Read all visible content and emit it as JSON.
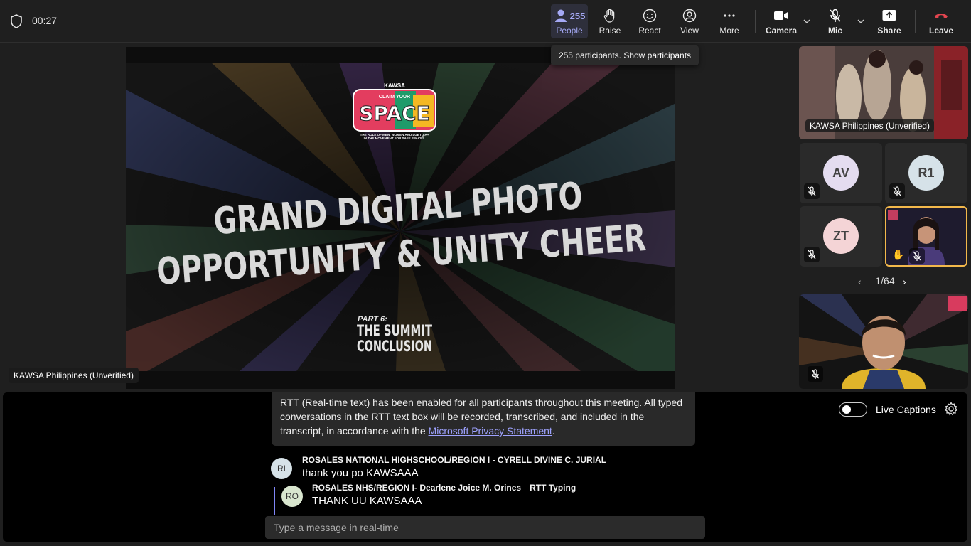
{
  "header": {
    "timer": "00:27",
    "people": {
      "count": "255",
      "label": "People"
    },
    "raise": "Raise",
    "react": "React",
    "view": "View",
    "more": "More",
    "camera": "Camera",
    "mic": "Mic",
    "share": "Share",
    "leave": "Leave"
  },
  "tooltip": "255 participants. Show participants",
  "stage": {
    "brand": "KAWSA",
    "logo_top": "CLAIM YOUR",
    "logo_main": "SPACE",
    "logo_sub1": "THE ROLE OF MEN, WOMEN AND LGBTQIA+",
    "logo_sub2": "IN THE MOVEMENT FOR SAFE SPACES.",
    "title_line1": "GRAND DIGITAL PHOTO",
    "title_line2": "OPPORTUNITY & UNITY CHEER",
    "part": "PART 6:",
    "part_title1": "THE SUMMIT",
    "part_title2": "CONCLUSION",
    "presenter": "KAWSA Philippines (Unverified)"
  },
  "rail": {
    "top_tile_name": "KAWSA Philippines (Unverified)",
    "participants": [
      {
        "initials": "AV",
        "color": "#e4dcf0"
      },
      {
        "initials": "R1",
        "color": "#d6e2e8"
      },
      {
        "initials": "ZT",
        "color": "#f4d4d6"
      }
    ],
    "pager": "1/64"
  },
  "rtt": {
    "notice_text": "RTT (Real-time text) has been enabled for all participants throughout this meeting. All typed conversations in the RTT text box will be recorded, transcribed, and included in the transcript, in accordance with the ",
    "notice_link": "Microsoft Privacy Statement",
    "notice_end": ".",
    "messages": [
      {
        "initials": "RI",
        "name": "ROSALES NATIONAL HIGHSCHOOL/REGION I - CYRELL DIVINE C. JURIAL",
        "text": "thank you po KAWSAAA"
      },
      {
        "initials": "RO",
        "name": "ROSALES NHS/REGION I- Dearlene Joice M. Orines",
        "status": "RTT Typing",
        "text": "THANK UU KAWSAAA"
      }
    ],
    "placeholder": "Type a message in real-time",
    "live_captions": "Live Captions"
  }
}
